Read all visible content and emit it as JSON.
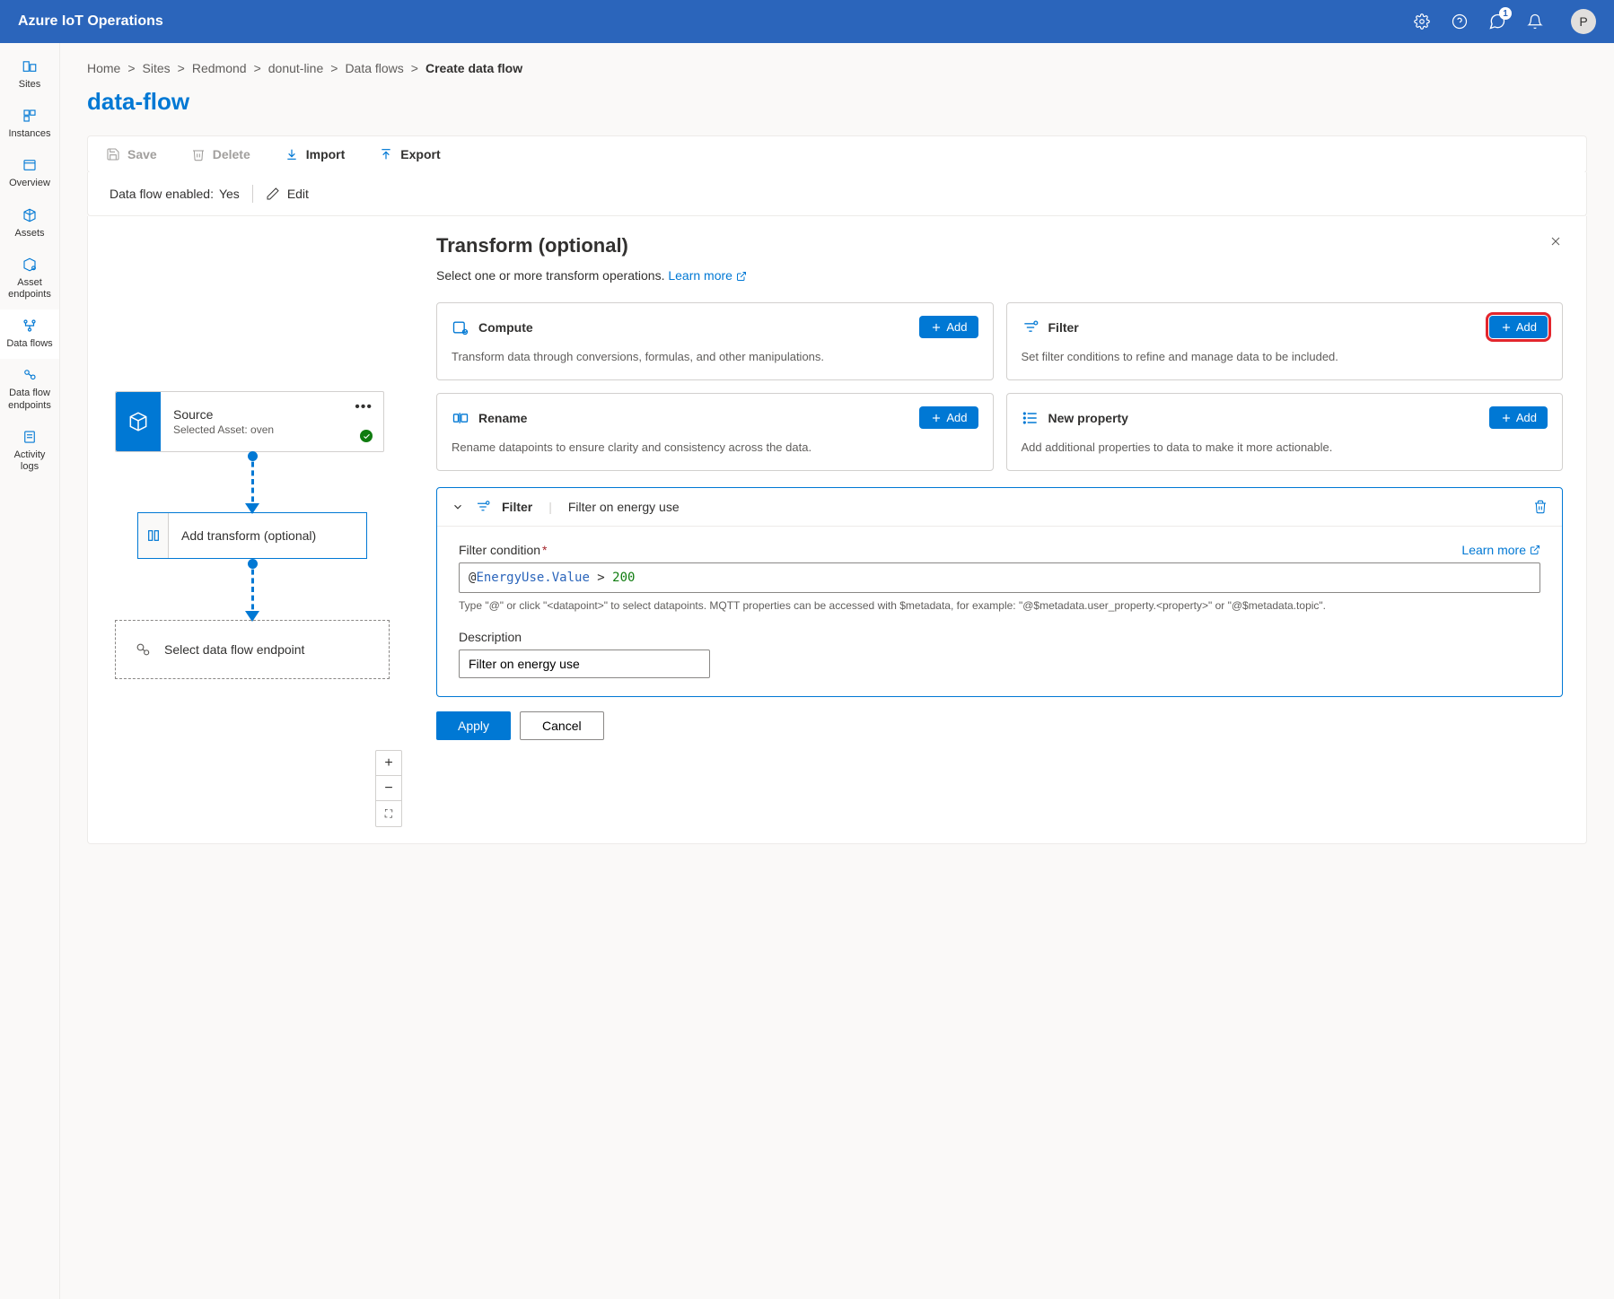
{
  "header": {
    "title": "Azure IoT Operations",
    "notification_count": "1",
    "avatar_initial": "P"
  },
  "sidebar": {
    "items": [
      {
        "label": "Sites"
      },
      {
        "label": "Instances"
      },
      {
        "label": "Overview"
      },
      {
        "label": "Assets"
      },
      {
        "label": "Asset endpoints"
      },
      {
        "label": "Data flows"
      },
      {
        "label": "Data flow endpoints"
      },
      {
        "label": "Activity logs"
      }
    ]
  },
  "breadcrumb": {
    "items": [
      "Home",
      "Sites",
      "Redmond",
      "donut-line",
      "Data flows"
    ],
    "current": "Create data flow"
  },
  "page": {
    "title": "data-flow"
  },
  "toolbar": {
    "save": "Save",
    "delete": "Delete",
    "import": "Import",
    "export": "Export"
  },
  "enabled": {
    "label": "Data flow enabled:",
    "value": "Yes",
    "edit": "Edit"
  },
  "canvas": {
    "source": {
      "title": "Source",
      "subtitle": "Selected Asset: oven"
    },
    "transform": {
      "label": "Add transform (optional)"
    },
    "endpoint": {
      "label": "Select data flow endpoint"
    }
  },
  "panel": {
    "title": "Transform (optional)",
    "subtitle_prefix": "Select one or more transform operations. ",
    "learn_more": "Learn more",
    "cards": {
      "compute": {
        "title": "Compute",
        "desc": "Transform data through conversions, formulas, and other manipulations.",
        "add": "Add"
      },
      "filter": {
        "title": "Filter",
        "desc": "Set filter conditions to refine and manage data to be included.",
        "add": "Add"
      },
      "rename": {
        "title": "Rename",
        "desc": "Rename datapoints to ensure clarity and consistency across the data.",
        "add": "Add"
      },
      "newprop": {
        "title": "New property",
        "desc": "Add additional properties to data to make it more actionable.",
        "add": "Add"
      }
    },
    "editor": {
      "head_label": "Filter",
      "head_value": "Filter on energy use",
      "condition_label": "Filter condition",
      "learn_more": "Learn more",
      "condition_at": "@",
      "condition_prop": "EnergyUse.Value",
      "condition_op": " > ",
      "condition_val": "200",
      "hint": "Type \"@\" or click \"<datapoint>\" to select datapoints. MQTT properties can be accessed with $metadata, for example: \"@$metadata.user_property.<property>\" or \"@$metadata.topic\".",
      "desc_label": "Description",
      "desc_value": "Filter on energy use"
    },
    "apply": "Apply",
    "cancel": "Cancel"
  }
}
